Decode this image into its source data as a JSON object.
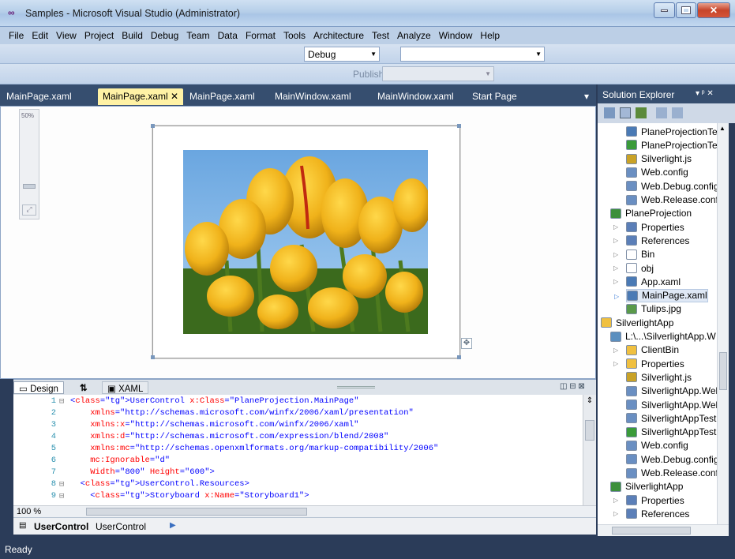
{
  "window": {
    "title": "Samples - Microsoft Visual Studio (Administrator)",
    "logo": "vs-infinity-logo"
  },
  "menu": [
    "File",
    "Edit",
    "View",
    "Project",
    "Build",
    "Debug",
    "Team",
    "Data",
    "Format",
    "Tools",
    "Architecture",
    "Test",
    "Analyze",
    "Window",
    "Help"
  ],
  "toolbar": {
    "config": "Debug",
    "platform": "",
    "publish_label": "Publish:"
  },
  "tabs": [
    {
      "label": "MainPage.xaml",
      "active": false
    },
    {
      "label": "MainPage.xaml",
      "active": true
    },
    {
      "label": "MainPage.xaml",
      "active": false
    },
    {
      "label": "MainWindow.xaml",
      "active": false
    },
    {
      "label": "MainWindow.xaml",
      "active": false
    },
    {
      "label": "Start Page",
      "active": false
    }
  ],
  "designer": {
    "zoom": "50%",
    "image": "tulips-photo"
  },
  "split": {
    "design": "Design",
    "swap": "⇅",
    "xaml": "XAML"
  },
  "code": [
    {
      "n": "1",
      "t": "<UserControl x:Class=\"PlaneProjection.MainPage\""
    },
    {
      "n": "2",
      "t": "    xmlns=\"http://schemas.microsoft.com/winfx/2006/xaml/presentation\""
    },
    {
      "n": "3",
      "t": "    xmlns:x=\"http://schemas.microsoft.com/winfx/2006/xaml\""
    },
    {
      "n": "4",
      "t": "    xmlns:d=\"http://schemas.microsoft.com/expression/blend/2008\""
    },
    {
      "n": "5",
      "t": "    xmlns:mc=\"http://schemas.openxmlformats.org/markup-compatibility/2006\""
    },
    {
      "n": "6",
      "t": "    mc:Ignorable=\"d\""
    },
    {
      "n": "7",
      "t": "    Width=\"800\" Height=\"600\">"
    },
    {
      "n": "8",
      "t": "  <UserControl.Resources>"
    },
    {
      "n": "9",
      "t": "    <Storyboard x:Name=\"Storyboard1\">"
    }
  ],
  "code_zoom": "100 %",
  "breadcrumb": {
    "bold": "UserControl",
    "rest": "UserControl"
  },
  "solution": {
    "title": "Solution Explorer",
    "items": [
      {
        "label": "PlaneProjectionTe",
        "indent": 2,
        "icon": "page",
        "color": "#4a7ab5"
      },
      {
        "label": "PlaneProjectionTe",
        "indent": 2,
        "icon": "page",
        "color": "#3a9b3a"
      },
      {
        "label": "Silverlight.js",
        "indent": 2,
        "icon": "js",
        "color": "#c9a227"
      },
      {
        "label": "Web.config",
        "indent": 2,
        "icon": "config",
        "color": "#6a8fc2"
      },
      {
        "label": "Web.Debug.config",
        "indent": 2,
        "icon": "config",
        "color": "#6a8fc2"
      },
      {
        "label": "Web.Release.confi",
        "indent": 2,
        "icon": "config",
        "color": "#6a8fc2"
      },
      {
        "label": "PlaneProjection",
        "indent": 1,
        "icon": "project",
        "color": "#3c8f3c"
      },
      {
        "label": "Properties",
        "indent": 2,
        "icon": "folder-props",
        "color": "#5b7fb8",
        "arrow": true
      },
      {
        "label": "References",
        "indent": 2,
        "icon": "folder-refs",
        "color": "#5b7fb8",
        "arrow": true
      },
      {
        "label": "Bin",
        "indent": 2,
        "icon": "folder",
        "color": "#ffffff",
        "arrow": true
      },
      {
        "label": "obj",
        "indent": 2,
        "icon": "folder",
        "color": "#ffffff",
        "arrow": true
      },
      {
        "label": "App.xaml",
        "indent": 2,
        "icon": "xaml",
        "color": "#4a7ab5",
        "arrow": true
      },
      {
        "label": "MainPage.xaml",
        "indent": 2,
        "icon": "xaml",
        "color": "#4a7ab5",
        "arrow": true,
        "selected": true
      },
      {
        "label": "Tulips.jpg",
        "indent": 2,
        "icon": "image",
        "color": "#5a9a4a"
      },
      {
        "label": "SilverlightApp",
        "indent": 0,
        "icon": "folder",
        "color": "#f0c040"
      },
      {
        "label": "L:\\...\\SilverlightApp.W",
        "indent": 1,
        "icon": "web",
        "color": "#5b8fbf"
      },
      {
        "label": "ClientBin",
        "indent": 2,
        "icon": "folder",
        "color": "#f0c040",
        "arrow": true
      },
      {
        "label": "Properties",
        "indent": 2,
        "icon": "folder",
        "color": "#f0c040",
        "arrow": true
      },
      {
        "label": "Silverlight.js",
        "indent": 2,
        "icon": "js",
        "color": "#c9a227"
      },
      {
        "label": "SilverlightApp.Wel",
        "indent": 2,
        "icon": "page",
        "color": "#6a8fc2"
      },
      {
        "label": "SilverlightApp.Wel",
        "indent": 2,
        "icon": "page",
        "color": "#6a8fc2"
      },
      {
        "label": "SilverlightAppTest",
        "indent": 2,
        "icon": "page",
        "color": "#6a8fc2"
      },
      {
        "label": "SilverlightAppTest",
        "indent": 2,
        "icon": "page",
        "color": "#3a9b3a"
      },
      {
        "label": "Web.config",
        "indent": 2,
        "icon": "config",
        "color": "#6a8fc2"
      },
      {
        "label": "Web.Debug.config",
        "indent": 2,
        "icon": "config",
        "color": "#6a8fc2"
      },
      {
        "label": "Web.Release.confi",
        "indent": 2,
        "icon": "config",
        "color": "#6a8fc2"
      },
      {
        "label": "SilverlightApp",
        "indent": 1,
        "icon": "project",
        "color": "#3c8f3c"
      },
      {
        "label": "Properties",
        "indent": 2,
        "icon": "folder-props",
        "color": "#5b7fb8",
        "arrow": true
      },
      {
        "label": "References",
        "indent": 2,
        "icon": "folder-refs",
        "color": "#5b7fb8",
        "arrow": true
      }
    ]
  },
  "status": "Ready"
}
